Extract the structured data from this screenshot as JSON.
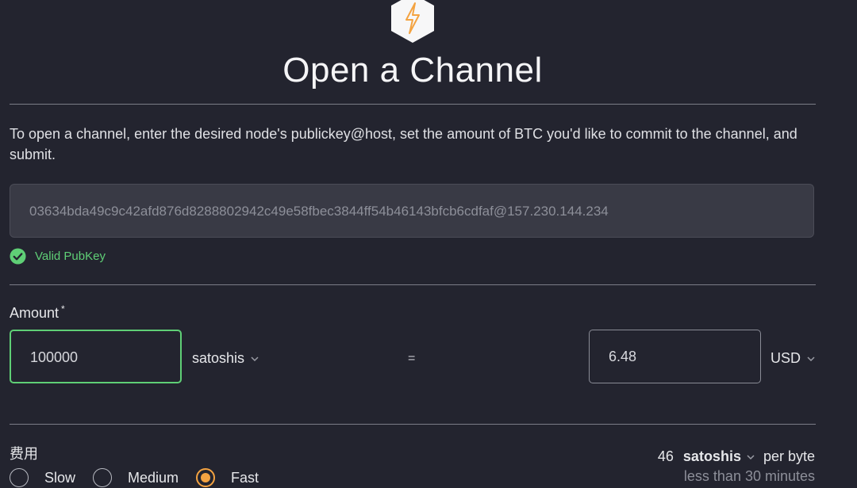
{
  "header": {
    "title": "Open a Channel",
    "logo_icon": "lightning-bolt-hexagon"
  },
  "description": "To open a channel, enter the desired node's publickey@host, set the amount of BTC you'd like to commit to the channel, and submit.",
  "pubkey": {
    "value": "03634bda49c9c42afd876d8288802942c49e58fbec3844ff54b46143bfcb6cdfaf@157.230.144.234",
    "status_text": "Valid PubKey",
    "status_icon": "check-circle-icon",
    "status_color": "#5fcf76"
  },
  "amount": {
    "label": "Amount",
    "required_marker": "*",
    "crypto_value": "100000",
    "crypto_unit": "satoshis",
    "equals": "=",
    "fiat_value": "6.48",
    "fiat_unit": "USD"
  },
  "fee": {
    "label": "费用",
    "options": [
      {
        "label": "Slow",
        "selected": false
      },
      {
        "label": "Medium",
        "selected": false
      },
      {
        "label": "Fast",
        "selected": true
      }
    ],
    "rate": "46",
    "rate_unit": "satoshis",
    "rate_suffix": "per byte",
    "eta": "less than 30 minutes"
  },
  "colors": {
    "background": "#23242f",
    "accent_orange": "#f4a341",
    "valid_green": "#5fcf76"
  }
}
